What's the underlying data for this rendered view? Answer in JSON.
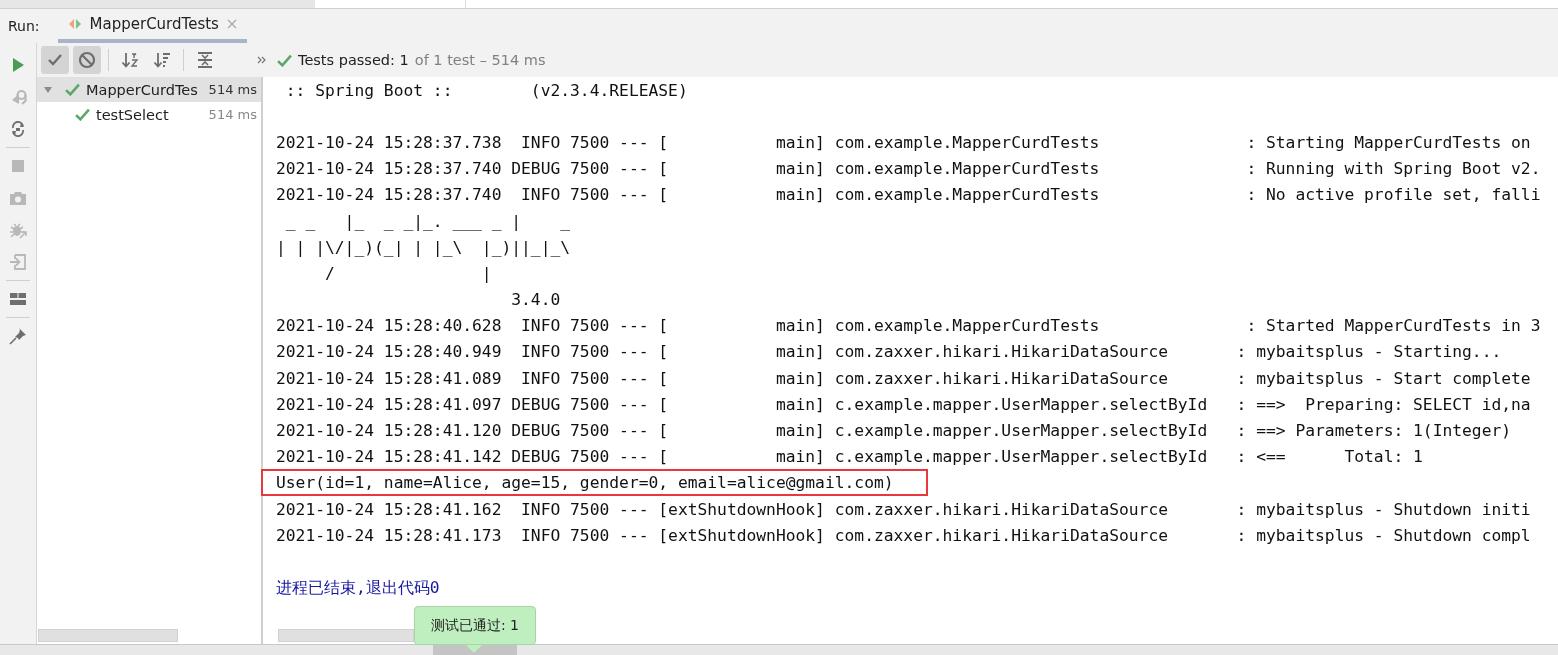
{
  "run_bar": {
    "label": "Run:",
    "tabs": [
      {
        "title": "MapperCurdTests",
        "selected": true
      }
    ]
  },
  "toolbar": {
    "buttons": [
      {
        "kind": "show-passed",
        "on": true
      },
      {
        "kind": "show-ignored",
        "on": true
      },
      {
        "kind": "sort-alpha",
        "on": false
      },
      {
        "kind": "sort-duration",
        "on": false
      },
      {
        "kind": "collapse",
        "on": false
      }
    ],
    "status": {
      "label": "Tests passed: 1",
      "detail": "of 1 test – 514 ms"
    }
  },
  "side_tools": [
    {
      "kind": "run",
      "disabled": false
    },
    {
      "kind": "rerun-failed",
      "disabled": true
    },
    {
      "kind": "auto-test",
      "disabled": false
    },
    {
      "kind": "stop",
      "disabled": true
    },
    {
      "kind": "snapshot",
      "disabled": true
    },
    {
      "kind": "debug",
      "disabled": true
    },
    {
      "kind": "export",
      "disabled": true
    },
    {
      "kind": "layout",
      "disabled": false
    },
    {
      "kind": "pin",
      "disabled": false
    }
  ],
  "tree": [
    {
      "name": "MapperCurdTes",
      "time": "514 ms",
      "passed": true,
      "selected": true,
      "expanded": true,
      "children": [
        {
          "name": "testSelect",
          "time": "514 ms",
          "passed": true,
          "selected": false
        }
      ]
    }
  ],
  "console": {
    "lines": [
      {
        "kind": "plain",
        "text": " :: Spring Boot ::        (v2.3.4.RELEASE)",
        "highlighted": false
      },
      {
        "kind": "blank"
      },
      {
        "kind": "plain",
        "text": "2021-10-24 15:28:37.738  INFO 7500 --- [           main] com.example.MapperCurdTests               : Starting MapperCurdTests on",
        "highlighted": false
      },
      {
        "kind": "plain",
        "text": "2021-10-24 15:28:37.740 DEBUG 7500 --- [           main] com.example.MapperCurdTests               : Running with Spring Boot v2.",
        "highlighted": false
      },
      {
        "kind": "plain",
        "text": "2021-10-24 15:28:37.740  INFO 7500 --- [           main] com.example.MapperCurdTests               : No active profile set, falli",
        "highlighted": false
      },
      {
        "kind": "plain",
        "text": " _ _   |_  _ _|_. ___ _ |    _",
        "highlighted": false
      },
      {
        "kind": "plain",
        "text": "| | |\\/|_)(_| | |_\\  |_)||_|_\\",
        "highlighted": false
      },
      {
        "kind": "plain",
        "text": "     /               |",
        "highlighted": false
      },
      {
        "kind": "plain",
        "text": "                        3.4.0",
        "highlighted": false
      },
      {
        "kind": "plain",
        "text": "2021-10-24 15:28:40.628  INFO 7500 --- [           main] com.example.MapperCurdTests               : Started MapperCurdTests in 3",
        "highlighted": false
      },
      {
        "kind": "plain",
        "text": "2021-10-24 15:28:40.949  INFO 7500 --- [           main] com.zaxxer.hikari.HikariDataSource       : mybaitsplus - Starting...",
        "highlighted": false
      },
      {
        "kind": "plain",
        "text": "2021-10-24 15:28:41.089  INFO 7500 --- [           main] com.zaxxer.hikari.HikariDataSource       : mybaitsplus - Start complete",
        "highlighted": false
      },
      {
        "kind": "plain",
        "text": "2021-10-24 15:28:41.097 DEBUG 7500 --- [           main] c.example.mapper.UserMapper.selectById   : ==>  Preparing: SELECT id,na",
        "highlighted": false
      },
      {
        "kind": "plain",
        "text": "2021-10-24 15:28:41.120 DEBUG 7500 --- [           main] c.example.mapper.UserMapper.selectById   : ==> Parameters: 1(Integer)",
        "highlighted": false
      },
      {
        "kind": "plain",
        "text": "2021-10-24 15:28:41.142 DEBUG 7500 --- [           main] c.example.mapper.UserMapper.selectById   : <==      Total: 1",
        "highlighted": false
      },
      {
        "kind": "plain",
        "text": "User(id=1, name=Alice, age=15, gender=0, email=alice@gmail.com)",
        "highlighted": true
      },
      {
        "kind": "plain",
        "text": "2021-10-24 15:28:41.162  INFO 7500 --- [extShutdownHook] com.zaxxer.hikari.HikariDataSource       : mybaitsplus - Shutdown initi",
        "highlighted": false
      },
      {
        "kind": "plain",
        "text": "2021-10-24 15:28:41.173  INFO 7500 --- [extShutdownHook] com.zaxxer.hikari.HikariDataSource       : mybaitsplus - Shutdown compl",
        "highlighted": false
      },
      {
        "kind": "blank"
      },
      {
        "kind": "exit",
        "text": "进程已结束,退出代码0",
        "highlighted": false
      }
    ]
  },
  "tooltip": {
    "text": "测试已通过: 1"
  }
}
